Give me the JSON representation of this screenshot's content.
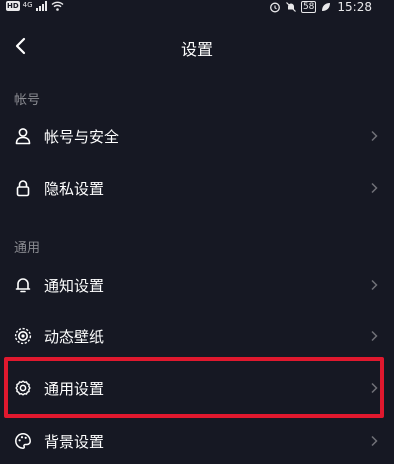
{
  "status_bar": {
    "hd_badge": "HD",
    "network": "4G",
    "battery": "58",
    "time": "15:28"
  },
  "header": {
    "title": "设置"
  },
  "sections": {
    "account": {
      "header": "帐号",
      "items": [
        {
          "label": "帐号与安全",
          "icon": "person-icon"
        },
        {
          "label": "隐私设置",
          "icon": "lock-icon"
        }
      ]
    },
    "general": {
      "header": "通用",
      "items": [
        {
          "label": "通知设置",
          "icon": "bell-icon"
        },
        {
          "label": "动态壁纸",
          "icon": "live-wallpaper-icon"
        },
        {
          "label": "通用设置",
          "icon": "gear-icon",
          "highlighted": true
        },
        {
          "label": "背景设置",
          "icon": "palette-icon"
        }
      ]
    }
  },
  "colors": {
    "background": "#161823",
    "text_primary": "#ffffff",
    "text_secondary": "#8a8b91",
    "chevron": "#6f7077",
    "highlight": "#e0182e"
  }
}
